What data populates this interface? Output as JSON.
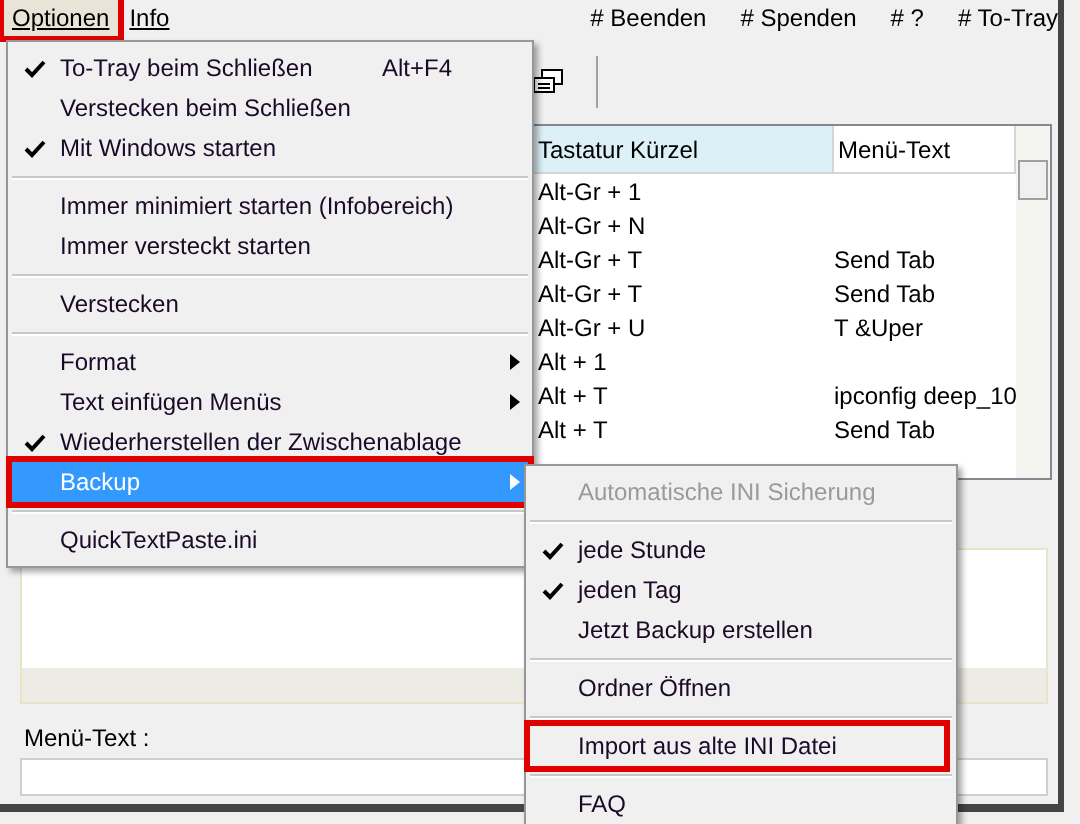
{
  "menubar": {
    "items": [
      {
        "label": "Optionen",
        "selected": true,
        "annotated": true
      },
      {
        "label": "Info",
        "selected": false,
        "annotated": false
      }
    ],
    "links": [
      "# Beenden",
      "# Spenden",
      "# ?",
      "# To-Tray"
    ]
  },
  "table": {
    "columns": [
      "Tastatur Kürzel",
      "Menü-Text"
    ],
    "rows": [
      {
        "shortcut": "Alt-Gr + 1",
        "text": ""
      },
      {
        "shortcut": "Alt-Gr + N",
        "text": ""
      },
      {
        "shortcut": "Alt-Gr + T",
        "text": "Send Tab"
      },
      {
        "shortcut": "Alt-Gr + T",
        "text": "Send Tab"
      },
      {
        "shortcut": "Alt-Gr + U",
        "text": "T &Uper"
      },
      {
        "shortcut": "Alt + 1",
        "text": ""
      },
      {
        "shortcut": "Alt + T",
        "text": "ipconfig deep_10"
      },
      {
        "shortcut": "Alt + T",
        "text": "Send Tab"
      }
    ]
  },
  "label": "Menü-Text :",
  "menu": [
    {
      "kind": "item",
      "label": "To-Tray beim Schließen",
      "checked": true,
      "shortcut": "Alt+F4",
      "submenu": false,
      "selected": false,
      "annotated": false
    },
    {
      "kind": "item",
      "label": "Verstecken beim Schließen",
      "checked": false,
      "submenu": false,
      "selected": false,
      "annotated": false
    },
    {
      "kind": "item",
      "label": "Mit Windows starten",
      "checked": true,
      "submenu": false,
      "selected": false,
      "annotated": false
    },
    {
      "kind": "separator"
    },
    {
      "kind": "item",
      "label": "Immer minimiert starten (Infobereich)",
      "checked": false,
      "submenu": false,
      "selected": false,
      "annotated": false
    },
    {
      "kind": "item",
      "label": "Immer versteckt starten",
      "checked": false,
      "submenu": false,
      "selected": false,
      "annotated": false
    },
    {
      "kind": "separator"
    },
    {
      "kind": "item",
      "label": "Verstecken",
      "checked": false,
      "submenu": false,
      "selected": false,
      "annotated": false
    },
    {
      "kind": "separator"
    },
    {
      "kind": "item",
      "label": "Format",
      "checked": false,
      "submenu": true,
      "selected": false,
      "annotated": false
    },
    {
      "kind": "item",
      "label": "Text einfügen Menüs",
      "checked": false,
      "submenu": true,
      "selected": false,
      "annotated": false
    },
    {
      "kind": "item",
      "label": "Wiederherstellen der Zwischenablage",
      "checked": true,
      "submenu": false,
      "selected": false,
      "annotated": false
    },
    {
      "kind": "item",
      "label": "Backup",
      "checked": false,
      "submenu": true,
      "selected": true,
      "annotated": true
    },
    {
      "kind": "separator"
    },
    {
      "kind": "item",
      "label": "QuickTextPaste.ini",
      "checked": false,
      "submenu": false,
      "selected": false,
      "annotated": false
    }
  ],
  "submenu": [
    {
      "kind": "item",
      "label": "Automatische INI Sicherung",
      "checked": false,
      "disabled": true,
      "annotated": false
    },
    {
      "kind": "separator"
    },
    {
      "kind": "item",
      "label": "jede Stunde",
      "checked": true,
      "disabled": false,
      "annotated": false
    },
    {
      "kind": "item",
      "label": "jeden Tag",
      "checked": true,
      "disabled": false,
      "annotated": false
    },
    {
      "kind": "item",
      "label": "Jetzt Backup erstellen",
      "checked": false,
      "disabled": false,
      "annotated": false
    },
    {
      "kind": "separator"
    },
    {
      "kind": "item",
      "label": "Ordner Öffnen",
      "checked": false,
      "disabled": false,
      "annotated": false
    },
    {
      "kind": "separator"
    },
    {
      "kind": "item",
      "label": "Import aus alte INI Datei",
      "checked": false,
      "disabled": false,
      "annotated": true
    },
    {
      "kind": "separator"
    },
    {
      "kind": "item",
      "label": "FAQ",
      "checked": false,
      "disabled": false,
      "annotated": false
    }
  ]
}
